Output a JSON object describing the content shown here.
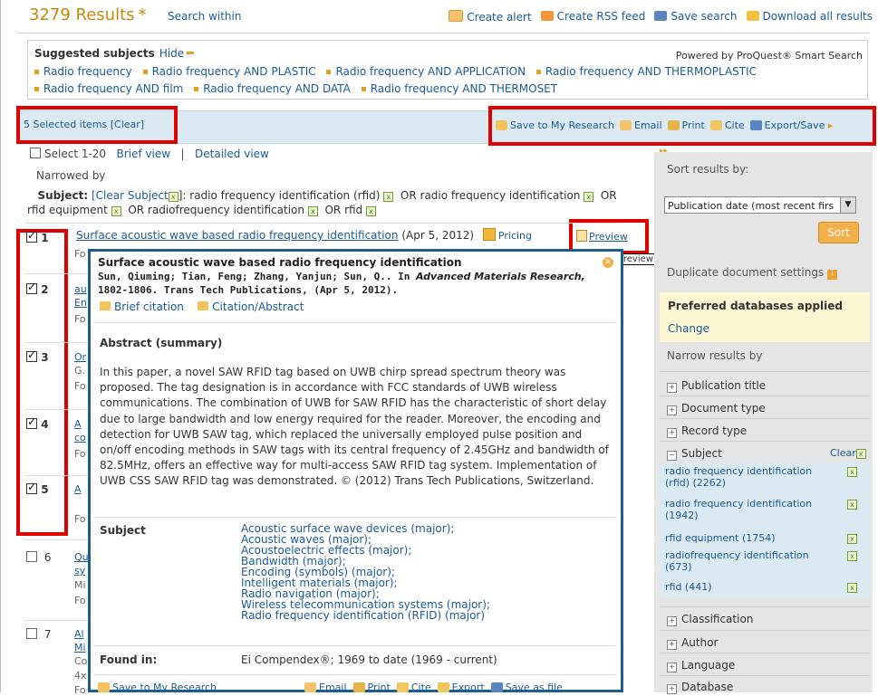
{
  "header": {
    "results": "3279 Results",
    "star": "*",
    "search_within": "Search within",
    "create_alert": "Create alert",
    "create_rss": "Create RSS feed",
    "save_search": "Save search",
    "download_all": "Download all results"
  },
  "suggested": {
    "title": "Suggested subjects",
    "hide": "Hide",
    "powered": "Powered by ProQuest® Smart Search",
    "row1": [
      "Radio frequency",
      "Radio frequency AND PLASTIC",
      "Radio frequency AND APPLICATION",
      "Radio frequency AND THERMOPLASTIC"
    ],
    "row2": [
      "Radio frequency AND film",
      "Radio frequency AND DATA",
      "Radio frequency AND THERMOSET"
    ]
  },
  "selection": {
    "count": "5 Selected items [Clear]",
    "save_research": "Save to My Research",
    "email": "Email",
    "print": "Print",
    "cite": "Cite",
    "export": "Export/Save"
  },
  "view": {
    "select": "Select 1-20",
    "brief": "Brief view",
    "sep": "|",
    "detailed": "Detailed view"
  },
  "narrowed": {
    "label": "Narrowed by",
    "subject_label": "Subject:",
    "clear_subject": "[Clear Subject",
    "clear_close": "]:",
    "t1": "radio frequency identification (rfid)",
    "or1": "OR radio frequency identification",
    "or2": "OR",
    "t3": "rfid equipment",
    "or3": "OR radiofrequency identification",
    "or4": "OR rfid"
  },
  "results": {
    "r1_title": "Surface acoustic wave based radio frequency identification",
    "r1_date": "(Apr 5, 2012)",
    "pricing": "Pricing",
    "preview": "Preview",
    "tooltip": "Preview document",
    "rows": [
      {
        "num": "1"
      },
      {
        "num": "2",
        "a": "au",
        "b": "En",
        "c": "Fo"
      },
      {
        "num": "3",
        "a": "Or",
        "b": "G.",
        "c": "Fo"
      },
      {
        "num": "4",
        "a": "A",
        "b": "co",
        "c": "Fo"
      },
      {
        "num": "5",
        "a": "A",
        "b": "",
        "c": "Fo"
      },
      {
        "num": "6",
        "a": "Qu",
        "b": "sy",
        "c": "Mi"
      },
      {
        "num": "7",
        "a": "Al",
        "b": "Mi",
        "c": "Co"
      }
    ],
    "row1_sub": "Fo",
    "row6_sub": "Fo",
    "row7_extra": "4x",
    "row7_fo": "Fo"
  },
  "popup": {
    "title": "Surface acoustic wave based radio frequency identification",
    "authors": "Sun, Qiuming; Tian, Feng; Zhang, Yanjun; Sun, Q.. In",
    "journal": "Advanced Materials Research,",
    "citation": "1802-1806. Trans Tech Publications, (Apr 5, 2012).",
    "brief_citation": "Brief citation",
    "citation_abstract": "Citation/Abstract",
    "abstract_heading": "Abstract (summary)",
    "abstract": "In this paper, a novel SAW RFID tag based on UWB chirp spread spectrum theory was proposed. The tag designation is in accordance with FCC standards of UWB wireless communications. The combination of UWB for SAW RFID has the characteristic of short delay due to large bandwidth and low energy required for the reader. Moreover, the encoding and detection for UWB SAW tag, which replaced the universally employed pulse position and on/off encoding methods in SAW tags with its central frequency of 2.45GHz and bandwidth of 82.5MHz, offers an effective way for multi-access SAW RFID tag system. Implementation of UWB CSS SAW RFID tag was demonstrated. © (2012) Trans Tech Publications, Switzerland.",
    "subject_heading": "Subject",
    "subjects": [
      "Acoustic surface wave devices (major);",
      "Acoustic waves (major);",
      "Acoustoelectric effects (major);",
      "Bandwidth (major);",
      "Encoding (symbols) (major);",
      "Intelligent materials (major);",
      "Radio navigation (major);",
      "Wireless telecommunication systems (major);",
      "Radio frequency identification (RFID) (major)"
    ],
    "found_heading": "Found in:",
    "found": "Ei Compendex®; 1969 to date (1969 - current)",
    "bottom_save": "Save to My Research",
    "bottom_email": "Email",
    "bottom_print": "Print",
    "bottom_cite": "Cite",
    "bottom_export": "Export",
    "bottom_savefile": "Save as file"
  },
  "sidebar": {
    "sort_heading": "Sort results by:",
    "sort_value": "Publication date (most recent firs",
    "sort_button": "Sort",
    "duplicate": "Duplicate document settings",
    "pref": "Preferred databases applied",
    "change": "Change",
    "narrow": "Narrow results by",
    "facets": [
      "Publication title",
      "Document type",
      "Record type"
    ],
    "subject": "Subject",
    "clear": "Clear",
    "subject_items": [
      "radio frequency identification (rfid) (2262)",
      "radio frequency identification (1942)",
      "rfid equipment (1754)",
      "radiofrequency identification (673)",
      "rfid (441)"
    ],
    "facets2": [
      "Classification",
      "Author",
      "Language",
      "Database"
    ]
  },
  "colors": {
    "accent_orange": "#c8860a",
    "link_blue": "#1a5a96",
    "highlight_red": "#e00000",
    "popup_border": "#1c5e8e"
  }
}
